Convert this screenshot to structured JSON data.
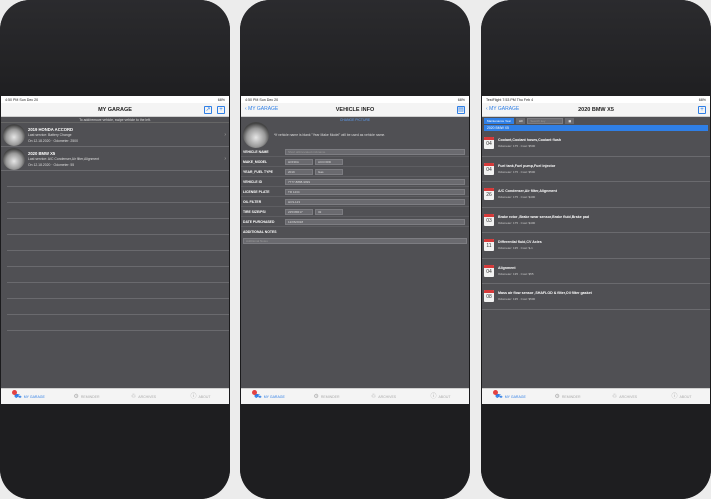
{
  "screen1": {
    "status": {
      "time": "4:50 PM",
      "day": "Sun Dec 20",
      "battery": "68%"
    },
    "title": "MY GARAGE",
    "hint": "To add/remove vehicle, swipe vehicle to the left.",
    "cars": [
      {
        "name": "2019 HONDA ACCORD",
        "line1": "Last service: Battery Change",
        "line2": "On 12.18.2020 · Odometer: 2500"
      },
      {
        "name": "2020 BMW X5",
        "line1": "Last service: A/C Condenser,Air filter,Alignment",
        "line2": "On 12.18.2020 · Odometer: 55"
      }
    ]
  },
  "screen2": {
    "status": {
      "time": "4:50 PM",
      "day": "Sun Dec 20",
      "battery": "68%"
    },
    "back": "MY GARAGE",
    "title": "VEHICLE INFO",
    "change_picture": "CHANGE PICTURE",
    "photo_note": "*If vehicle name is blank \"Year Make Model\" will be used as vehicle name.",
    "fields": {
      "vehicle_name": {
        "label": "VEHICLE NAME",
        "placeholder": "Short abbreviated nickname"
      },
      "make_model": {
        "label": "MAKE_MODEL",
        "make": "HONDA",
        "model": "ACCORD"
      },
      "year_fuel": {
        "label": "YEAR_FUEL TYPE",
        "year": "2019",
        "fuel": "Gas"
      },
      "vehicle_id": {
        "label": "VEHICLE ID",
        "value": "7777-8888-9999"
      },
      "license_plate": {
        "label": "LICENSE PLATE",
        "value": "TR 1234"
      },
      "oil_filter": {
        "label": "OIL FILTER",
        "value": "HC9-123"
      },
      "tire_size": {
        "label": "TIRE SIZE/PSI",
        "size": "225/45R17",
        "psi": "32"
      },
      "date_purchased": {
        "label": "DATE PURCHASED",
        "value": "12/06/2018"
      },
      "notes": {
        "label": "ADDITIONAL NOTES",
        "placeholder": "Additional Notes"
      }
    }
  },
  "screen3": {
    "status": {
      "time": "7:53 PM",
      "day": "Thu Feb 4",
      "battery": "68%",
      "carrier": "TestFlight"
    },
    "back": "MY GARAGE",
    "title": "2020 BMW X5",
    "segments": [
      "Maintenance Year",
      "All"
    ],
    "search_placeholder": "Search key",
    "group": "2020 BMW X5",
    "events": [
      {
        "day": "04",
        "title": "Coolant,Coolant hoses,Coolant flush",
        "sub": "Odometer: 175 · Cost: $500"
      },
      {
        "day": "04",
        "title": "Fuel tank,Fuel pump,Fuel injector",
        "sub": "Odometer: 175 · Cost: $500"
      },
      {
        "day": "26",
        "title": "A/C Condenser,Air filter,Alignment",
        "sub": "Odometer: 175 · Cost: $400"
      },
      {
        "day": "03",
        "title": "Brake rotor ,Brake wear sensor,Brake fluid,Brake pad",
        "sub": "Odometer: 175 · Cost: $400"
      },
      {
        "day": "11",
        "title": "Differential fluid,CV Axles",
        "sub": "Odometer: 135 · Cost: $-1"
      },
      {
        "day": "04",
        "title": "Alignment",
        "sub": "Odometer: 135 · Cost: $55"
      },
      {
        "day": "08",
        "title": "Mass air flow sensor ,SHAFLOD & filter,Oil filter gasket",
        "sub": "Odometer: 135 · Cost: $500"
      }
    ]
  },
  "tabs": [
    {
      "label": "MY GARAGE",
      "icon": "car-icon"
    },
    {
      "label": "REMINDER",
      "icon": "reminder-icon"
    },
    {
      "label": "ARCHIVES",
      "icon": "archives-icon"
    },
    {
      "label": "ABOUT",
      "icon": "info-icon"
    }
  ],
  "colors": {
    "accent": "#2f7fe6",
    "alert": "#d63a3a",
    "screen_bg": "#505054"
  }
}
